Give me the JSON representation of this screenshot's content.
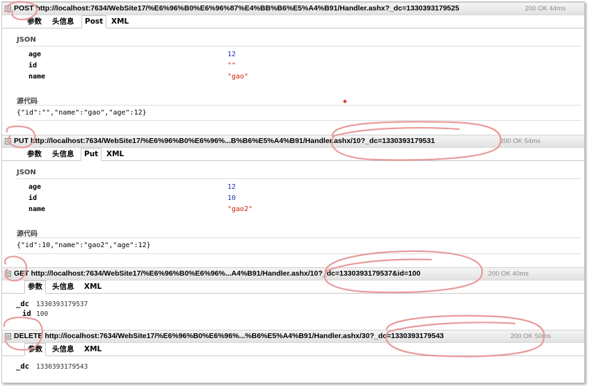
{
  "requests": [
    {
      "toggle": "⊟",
      "title": "POST http://localhost:7634/WebSite17/%E6%96%B0%E6%96%87%E4%BB%B6%E5%A4%B91/Handler.ashx?_dc=1330393179525",
      "status": "200 OK 44ms",
      "tabs": [
        "参数",
        "头信息",
        "Post",
        "XML"
      ],
      "active_tab": "Post",
      "json_label": "JSON",
      "fields": [
        {
          "key": "age",
          "value": "12",
          "kind": "number"
        },
        {
          "key": "id",
          "value": "\"\"",
          "kind": "string"
        },
        {
          "key": "name",
          "value": "\"gao\"",
          "kind": "string"
        }
      ],
      "source_label": "源代码",
      "source": "{\"id\":\"\",\"name\":\"gao\",\"age\":12}"
    },
    {
      "toggle": "⊟",
      "title": "PUT http://localhost:7634/WebSite17/%E6%96%B0%E6%96%...B%B6%E5%A4%B91/Handler.ashx/10?_dc=1330393179531",
      "status": "200 OK 54ms",
      "tabs": [
        "参数",
        "头信息",
        "Put",
        "XML"
      ],
      "active_tab": "Put",
      "json_label": "JSON",
      "fields": [
        {
          "key": "age",
          "value": "12",
          "kind": "number"
        },
        {
          "key": "id",
          "value": "10",
          "kind": "number"
        },
        {
          "key": "name",
          "value": "\"gao2\"",
          "kind": "string"
        }
      ],
      "source_label": "源代码",
      "source": "{\"id\":10,\"name\":\"gao2\",\"age\":12}"
    },
    {
      "toggle": "⊟",
      "title": "GET http://localhost:7634/WebSite17/%E6%96%B0%E6%96%...A4%B91/Handler.ashx/10?_dc=1330393179537&id=100",
      "status": "200 OK 40ms",
      "tabs": [
        "参数",
        "头信息",
        "XML"
      ],
      "active_tab": "参数",
      "params": [
        {
          "key": "_dc",
          "value": "1330393179537"
        },
        {
          "key": "id",
          "value": "100"
        }
      ]
    },
    {
      "toggle": "⊟",
      "title": "DELETE http://localhost:7634/WebSite17/%E6%96%B0%E6%96%...%B6%E5%A4%B91/Handler.ashx/30?_dc=1330393179543",
      "status": "200 OK 50ms",
      "tabs": [
        "参数",
        "头信息",
        "XML"
      ],
      "active_tab": "参数",
      "params": [
        {
          "key": "_dc",
          "value": "1330393179543"
        }
      ]
    }
  ],
  "colors": {
    "annotation": "#e89a9a",
    "string_value": "#cc2200",
    "number_value": "#2233aa"
  }
}
